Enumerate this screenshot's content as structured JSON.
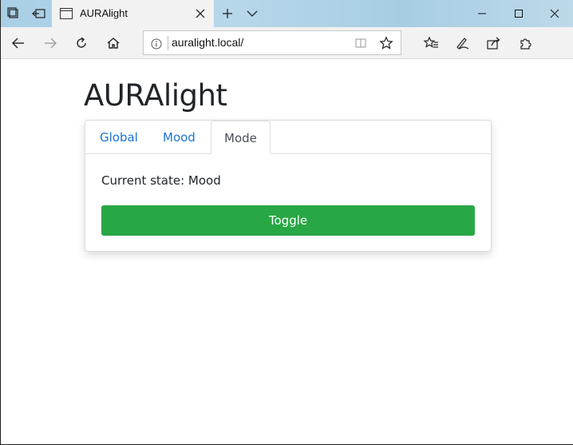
{
  "browser": {
    "tab": {
      "title": "AURAlight"
    },
    "address": {
      "url": "auralight.local/"
    }
  },
  "app": {
    "title": "AURAlight",
    "tabs": [
      {
        "label": "Global",
        "active": false
      },
      {
        "label": "Mood",
        "active": false
      },
      {
        "label": "Mode",
        "active": true
      }
    ],
    "state_label": "Current state: Mood",
    "toggle_label": "Toggle"
  },
  "colors": {
    "toggle_bg": "#28a745",
    "tab_link": "#1a73d9",
    "active_tab_text": "#495057"
  }
}
